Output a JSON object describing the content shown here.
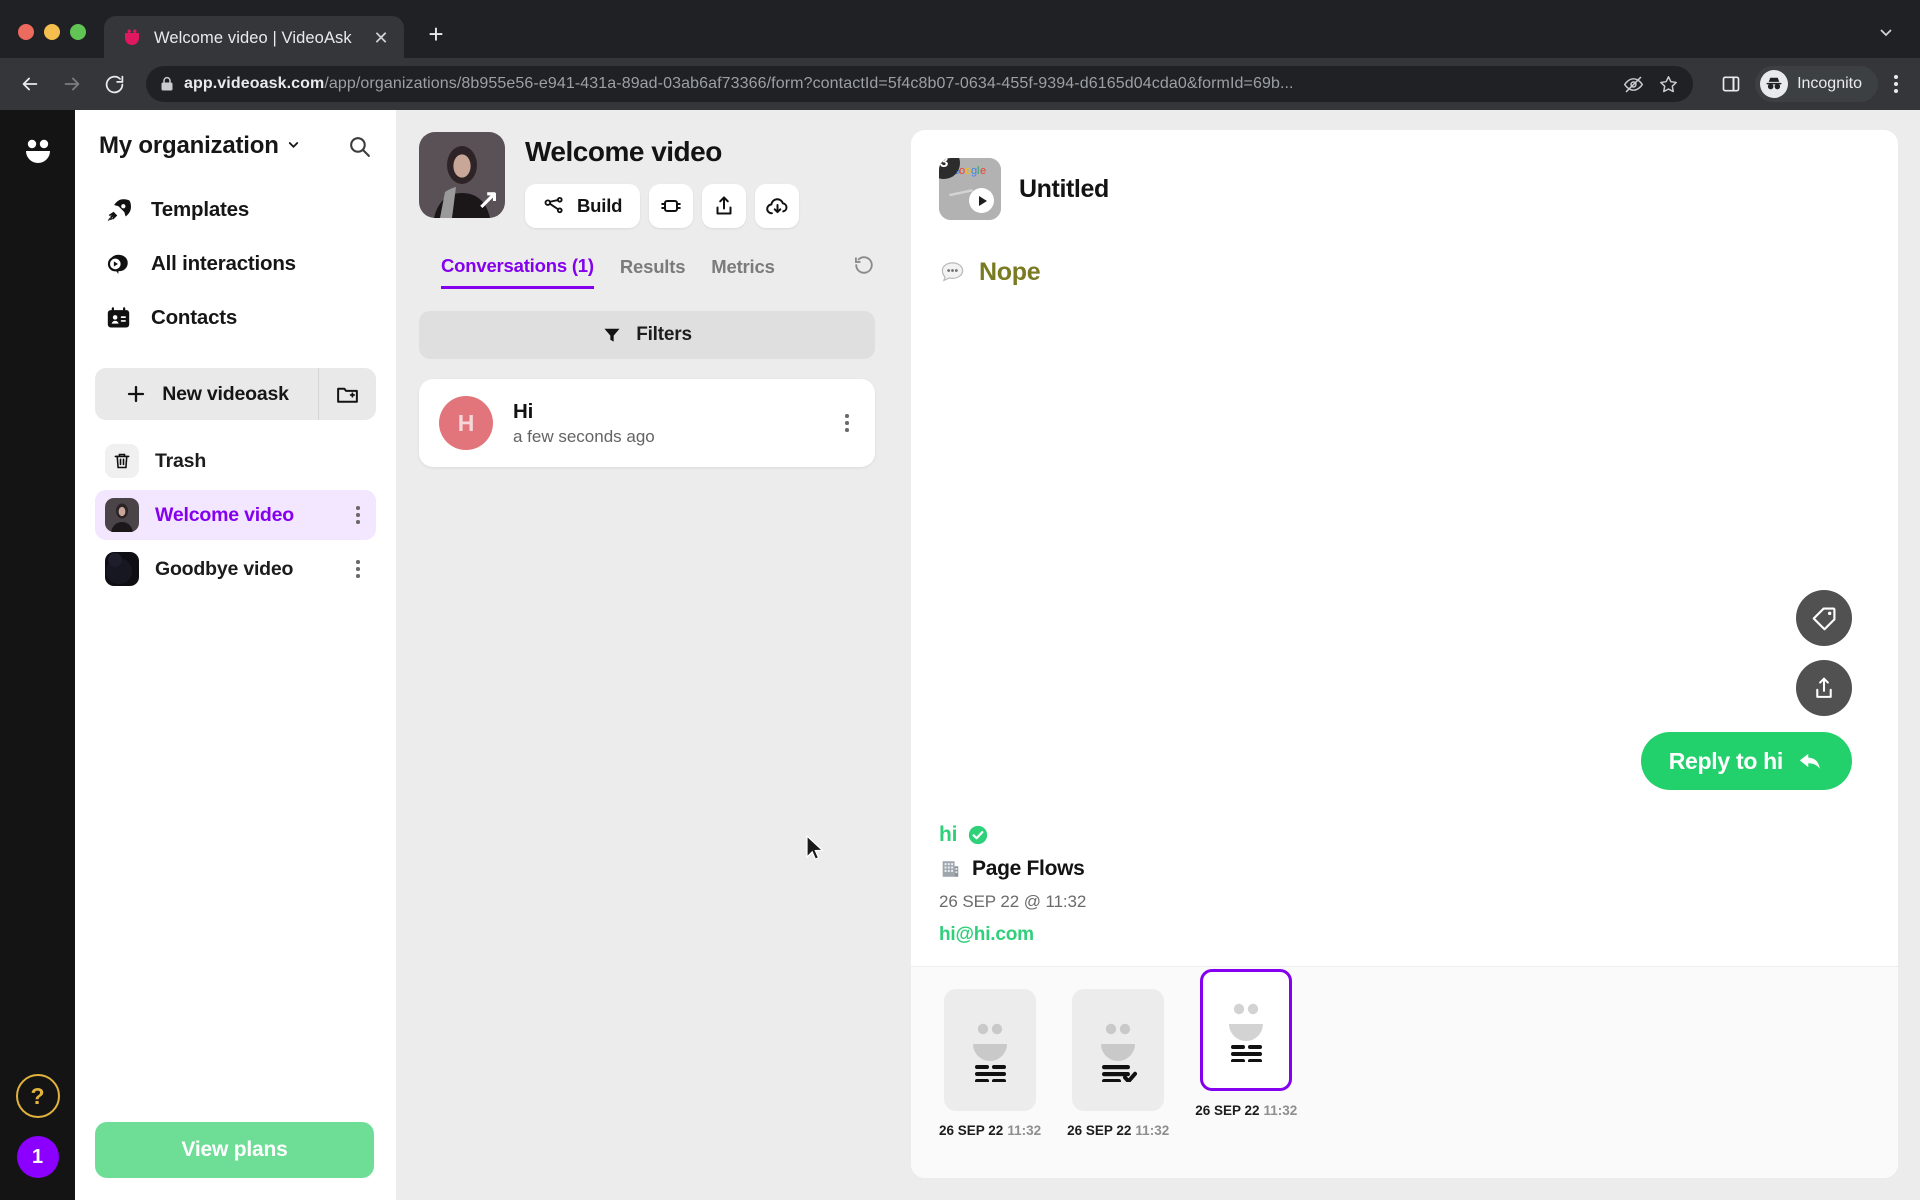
{
  "browser": {
    "tab_title": "Welcome video | VideoAsk",
    "tab_favicon_icon": "videoask-smile-icon",
    "close_tab_label": "✕",
    "new_tab_label": "+",
    "tabstrip_menu_icon": "chevron-down-icon",
    "back_icon": "back-arrow-icon",
    "forward_icon": "forward-arrow-icon",
    "reload_icon": "reload-icon",
    "lock_icon": "lock-icon",
    "url_bold": "app.videoask.com",
    "url_rest": "/app/organizations/8b955e56-e941-431a-89ad-03ab6af73366/form?contactId=5f4c8b07-0634-455f-9394-d6165d04cda0&formId=69b...",
    "tracking_icon": "eye-slash-icon",
    "bookmark_icon": "star-icon",
    "sidepanel_icon": "side-panel-icon",
    "incognito_label": "Incognito",
    "incognito_icon": "incognito-hat-icon",
    "menu_icon": "kebab-menu-icon"
  },
  "rail": {
    "logo_icon": "videoask-logo-icon",
    "help_label": "?",
    "notification_count": "1"
  },
  "sidebar": {
    "org_name": "My organization",
    "org_chevron_icon": "chevron-down-icon",
    "search_icon": "search-icon",
    "nav": [
      {
        "label": "Templates",
        "icon": "rocket-icon"
      },
      {
        "label": "All interactions",
        "icon": "play-bubble-icon"
      },
      {
        "label": "Contacts",
        "icon": "contacts-icon"
      }
    ],
    "new_videoask_label": "New videoask",
    "new_videoask_icon": "plus-icon",
    "new_folder_icon": "new-folder-icon",
    "items": [
      {
        "label": "Trash",
        "icon": "trash-icon",
        "active": false,
        "kebab": false
      },
      {
        "label": "Welcome video",
        "icon": "video-thumb-person",
        "active": true,
        "kebab": true
      },
      {
        "label": "Goodbye video",
        "icon": "video-thumb-dark",
        "active": false,
        "kebab": true
      }
    ],
    "view_plans_label": "View plans"
  },
  "center": {
    "hero_thumb_icon": "video-thumb-person",
    "open_arrow_icon": "arrow-up-right-icon",
    "title": "Welcome video",
    "buttons": [
      {
        "label": "Build",
        "icon": "flow-nodes-icon"
      },
      {
        "label": "",
        "icon": "embed-plug-icon"
      },
      {
        "label": "",
        "icon": "share-upload-icon"
      },
      {
        "label": "",
        "icon": "cloud-download-icon"
      }
    ],
    "tabs": [
      {
        "label": "Conversations (1)",
        "active": true
      },
      {
        "label": "Results",
        "active": false
      },
      {
        "label": "Metrics",
        "active": false
      }
    ],
    "refresh_icon": "refresh-icon",
    "filters_label": "Filters",
    "filters_icon": "funnel-icon",
    "conversations": [
      {
        "initial": "H",
        "name": "Hi",
        "time": "a few seconds ago",
        "kebab_icon": "kebab-menu-icon"
      }
    ]
  },
  "panel": {
    "step_badge": "3",
    "step_title": "Untitled",
    "play_icon": "play-icon",
    "answer_icon": "speech-bubble-icon",
    "answer_text": "Nope",
    "contact": {
      "name": "hi",
      "verified_icon": "verified-check-icon",
      "org_icon": "office-building-icon",
      "org": "Page Flows",
      "date": "26 SEP 22 @ 11:32",
      "email": "hi@hi.com"
    },
    "tag_button_icon": "tag-icon",
    "share_button_icon": "share-icon",
    "reply_label": "Reply to hi",
    "reply_icon": "reply-arrow-icon",
    "thumbnails": [
      {
        "date": "26 SEP 22",
        "time": "11:32",
        "icon": "face-text-icon",
        "selected": false
      },
      {
        "date": "26 SEP 22",
        "time": "11:32",
        "icon": "face-text-check-icon",
        "selected": false
      },
      {
        "date": "26 SEP 22",
        "time": "11:32",
        "icon": "face-text-icon",
        "selected": true
      }
    ]
  },
  "colors": {
    "accent_purple": "#8400ee",
    "accent_green": "#23d16c",
    "plan_green": "#6ede97",
    "answer_olive": "#7a7a22"
  }
}
